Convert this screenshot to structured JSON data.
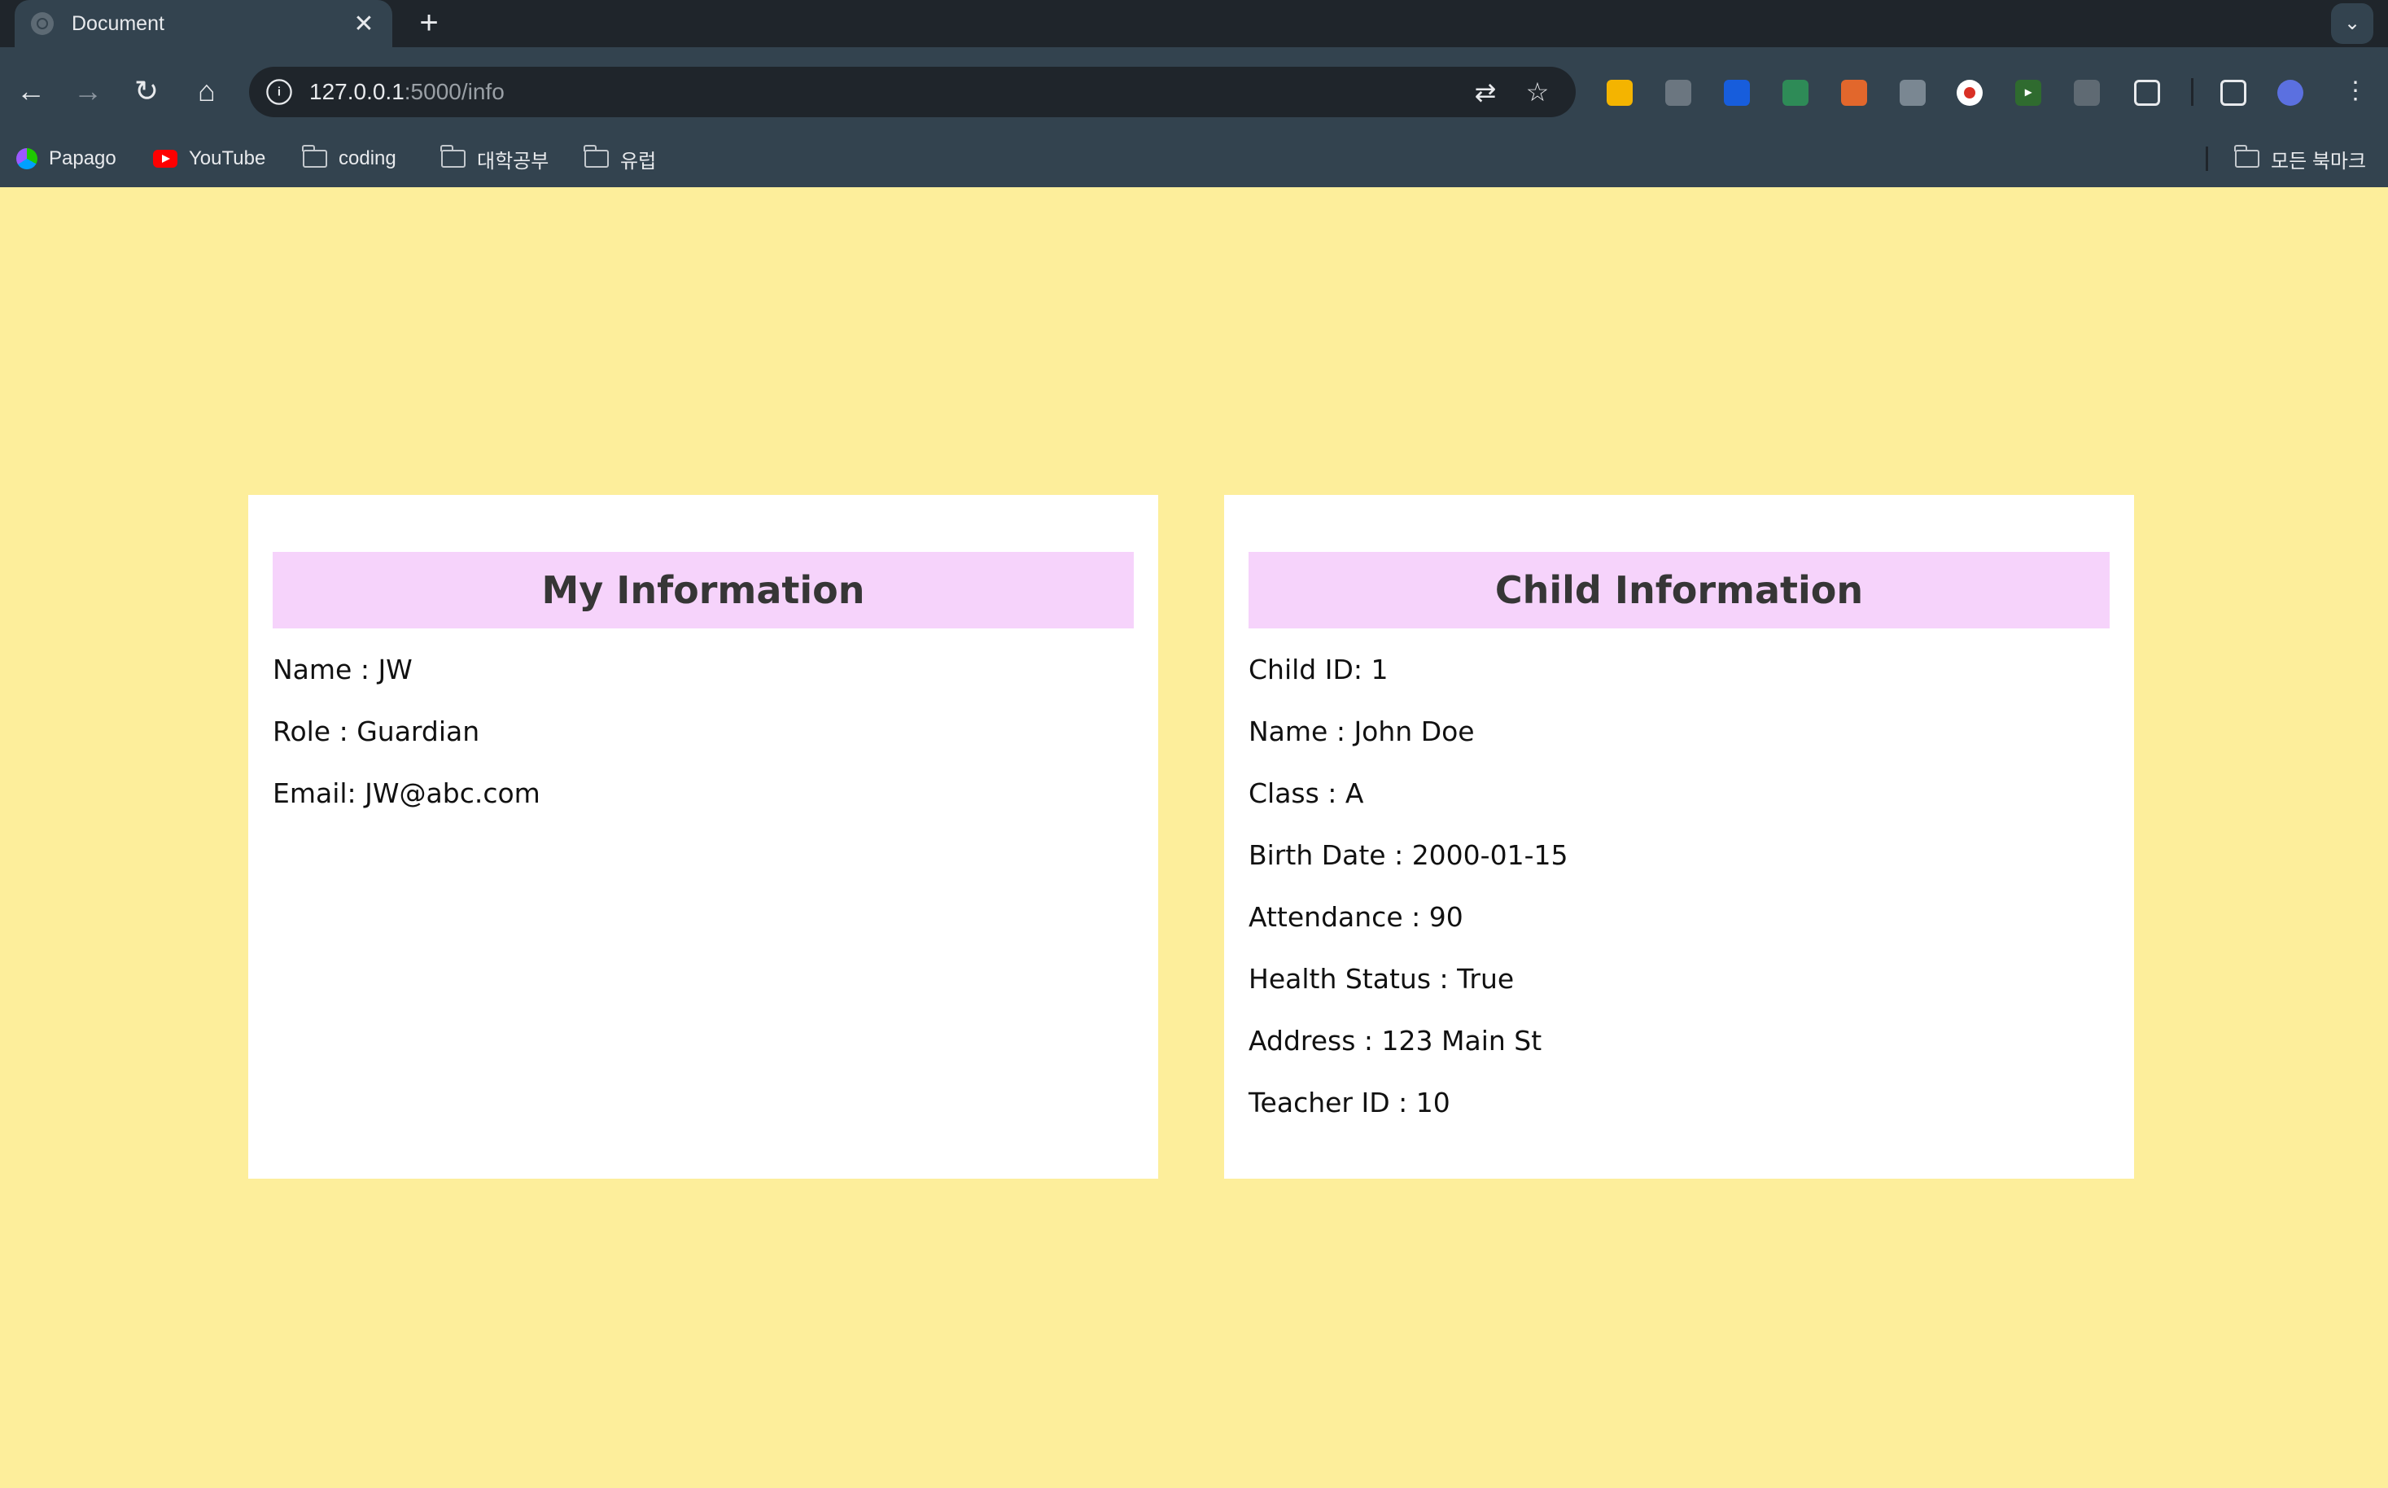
{
  "browser": {
    "tab_title": "Document",
    "tab_close": "✕",
    "new_tab": "+",
    "tab_dropdown": "⌄",
    "url_host": "127.0.0.1",
    "url_path": ":5000/info",
    "bookmarks": [
      {
        "label": "Papago",
        "icon": "papago-icon"
      },
      {
        "label": "YouTube",
        "icon": "youtube-icon"
      },
      {
        "label": "coding",
        "icon": "folder-icon"
      },
      {
        "label": "대학공부",
        "icon": "folder-icon"
      },
      {
        "label": "유럽",
        "icon": "folder-icon"
      }
    ],
    "all_bookmarks": "모든 북마크",
    "extensions": [
      {
        "icon": "keep-icon",
        "color": "#f4b400"
      },
      {
        "icon": "capture-icon",
        "color": "#6b7680"
      },
      {
        "icon": "bitwarden-icon",
        "color": "#175ddc"
      },
      {
        "icon": "screen-icon",
        "color": "#2e8b57"
      },
      {
        "icon": "ex-icon",
        "color": "#e2672c"
      },
      {
        "icon": "printer-icon",
        "color": "#7a8792"
      },
      {
        "icon": "record-icon",
        "color": "#d93025"
      },
      {
        "icon": "play-icon",
        "color": "#2f6b2f"
      },
      {
        "icon": "pin-icon",
        "color": "#5f6a73"
      }
    ]
  },
  "my_info": {
    "title": "My Information",
    "fields": [
      "Name : JW",
      "Role : Guardian",
      "Email: JW@abc.com"
    ]
  },
  "child_info": {
    "title": "Child Information",
    "fields": [
      "Child ID: 1",
      "Name : John Doe",
      "Class : A",
      "Birth Date : 2000-01-15",
      "Attendance : 90",
      "Health Status : True",
      "Address : 123 Main St",
      "Teacher ID : 10"
    ]
  },
  "colors": {
    "page_background": "#fdee9b",
    "card_header": "#f6d3fb",
    "card_background": "#ffffff",
    "chrome_dark": "#1f252b",
    "chrome_toolbar": "#33434f"
  }
}
